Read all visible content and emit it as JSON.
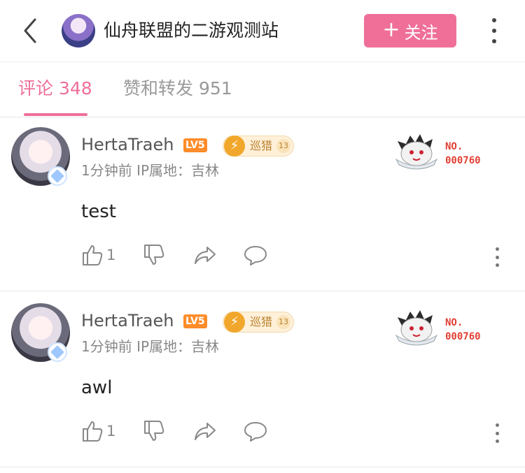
{
  "header": {
    "title": "仙舟联盟的二游观测站",
    "follow_plus": "+",
    "follow_label": "关注",
    "back_icon": "chevron-left-icon",
    "more_icon": "more-vertical-icon"
  },
  "tabs": [
    {
      "label": "评论 348",
      "active": true
    },
    {
      "label": "赞和转发 951",
      "active": false
    }
  ],
  "colors": {
    "accent": "#ef6f99",
    "level": "#ff8c2a",
    "badge_number": "#e33f33"
  },
  "comments": [
    {
      "username": "HertaTraeh",
      "level": "LV5",
      "honor": {
        "name": "巡猎",
        "count": "13"
      },
      "time": "1分钟前",
      "ip": "IP属地：吉林",
      "badge_label": "NO.",
      "badge_number": "000760",
      "text": "test",
      "likes": "1"
    },
    {
      "username": "HertaTraeh",
      "level": "LV5",
      "honor": {
        "name": "巡猎",
        "count": "13"
      },
      "time": "1分钟前",
      "ip": "IP属地：吉林",
      "badge_label": "NO.",
      "badge_number": "000760",
      "text": "awl",
      "likes": "1"
    }
  ]
}
